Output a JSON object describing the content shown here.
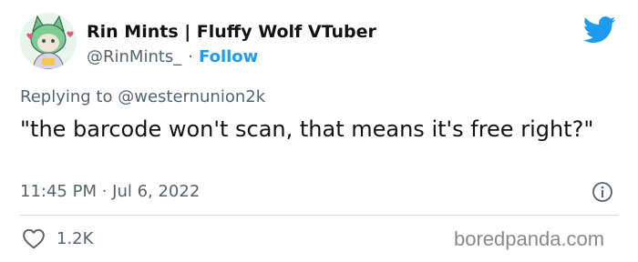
{
  "author": {
    "display_name": "Rin Mints | Fluffy Wolf VTuber",
    "handle": "@RinMints_",
    "separator": "·",
    "follow_label": "Follow",
    "avatar_icon": "avatar-wolf-character"
  },
  "platform_icon": "twitter-bird-icon",
  "reply": {
    "prefix": "Replying to",
    "target": "@westernunion2k"
  },
  "tweet": {
    "text": "\"the barcode won't scan, that means it's free right?\"",
    "timestamp": "11:45 PM · Jul 6, 2022"
  },
  "actions": {
    "like_count": "1.2K",
    "like_icon": "heart-icon",
    "info_icon": "info-icon"
  },
  "watermark": "boredpanda.com",
  "colors": {
    "accent": "#1d9bf0",
    "text": "#0f1419",
    "muted": "#536471",
    "divider": "#cfd9de"
  }
}
